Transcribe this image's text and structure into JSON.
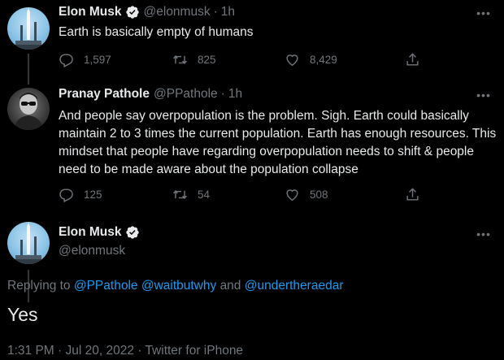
{
  "tweets": [
    {
      "name": "Elon Musk",
      "handle": "@elonmusk",
      "time": "1h",
      "text": "Earth is basically empty of humans",
      "replies": "1,597",
      "retweets": "825",
      "likes": "8,429"
    },
    {
      "name": "Pranay Pathole",
      "handle": "@PPathole",
      "time": "1h",
      "text": "And people say overpopulation is the problem. Sigh. Earth could basically maintain 2 to 3 times the current population. Earth has enough resources. This mindset that people have regarding overpopulation needs to shift & people need to be made aware about the population collapse",
      "replies": "125",
      "retweets": "54",
      "likes": "508"
    }
  ],
  "main_tweet": {
    "name": "Elon Musk",
    "handle": "@elonmusk",
    "replying_prefix": "Replying to",
    "replying_handles": [
      "@PPathole",
      "@waitbutwhy"
    ],
    "replying_and": "and",
    "replying_last": "@undertheraedar",
    "text": "Yes",
    "timestamp": "1:31 PM · Jul 20, 2022 · Twitter for iPhone"
  },
  "icons": {
    "reply": "reply-icon",
    "retweet": "retweet-icon",
    "like": "heart-icon",
    "share": "share-icon",
    "verified": "verified-badge-icon",
    "more": "more-options-icon"
  },
  "colors": {
    "background": "#000000",
    "text": "#e7e9ea",
    "secondary": "#71767b",
    "link": "#1d9bf0",
    "verified_badge": "#e7e9ea"
  }
}
